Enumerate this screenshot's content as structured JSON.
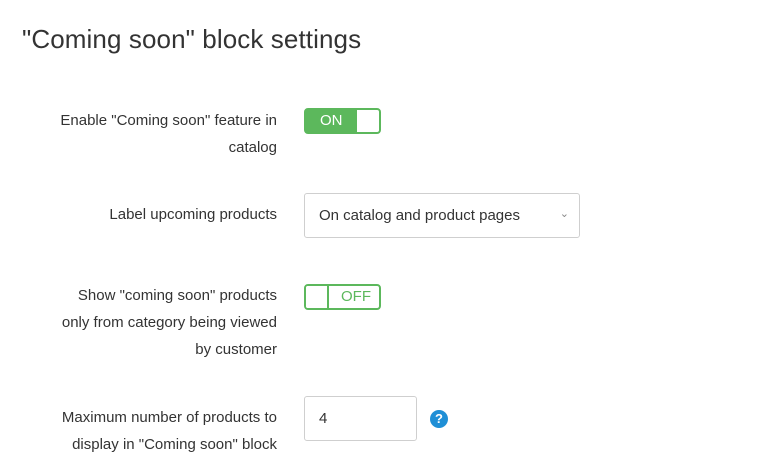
{
  "page": {
    "title": "\"Coming soon\" block settings"
  },
  "settings": {
    "enable_feature": {
      "label_line1": "Enable \"Coming soon\" feature in",
      "label_line2": "catalog",
      "state": "ON"
    },
    "label_upcoming": {
      "label": "Label upcoming products",
      "selected": "On catalog and product pages"
    },
    "category_only": {
      "label_line1": "Show \"coming soon\" products",
      "label_line2": "only from category being viewed",
      "label_line3": "by customer",
      "state": "OFF"
    },
    "max_products": {
      "label_line1": "Maximum number of products to",
      "label_line2": "display in \"Coming soon\" block",
      "value": "4",
      "help_icon": "question-circle-icon"
    }
  },
  "colors": {
    "toggle_green": "#5cb85c",
    "help_blue": "#1f8fd6"
  }
}
